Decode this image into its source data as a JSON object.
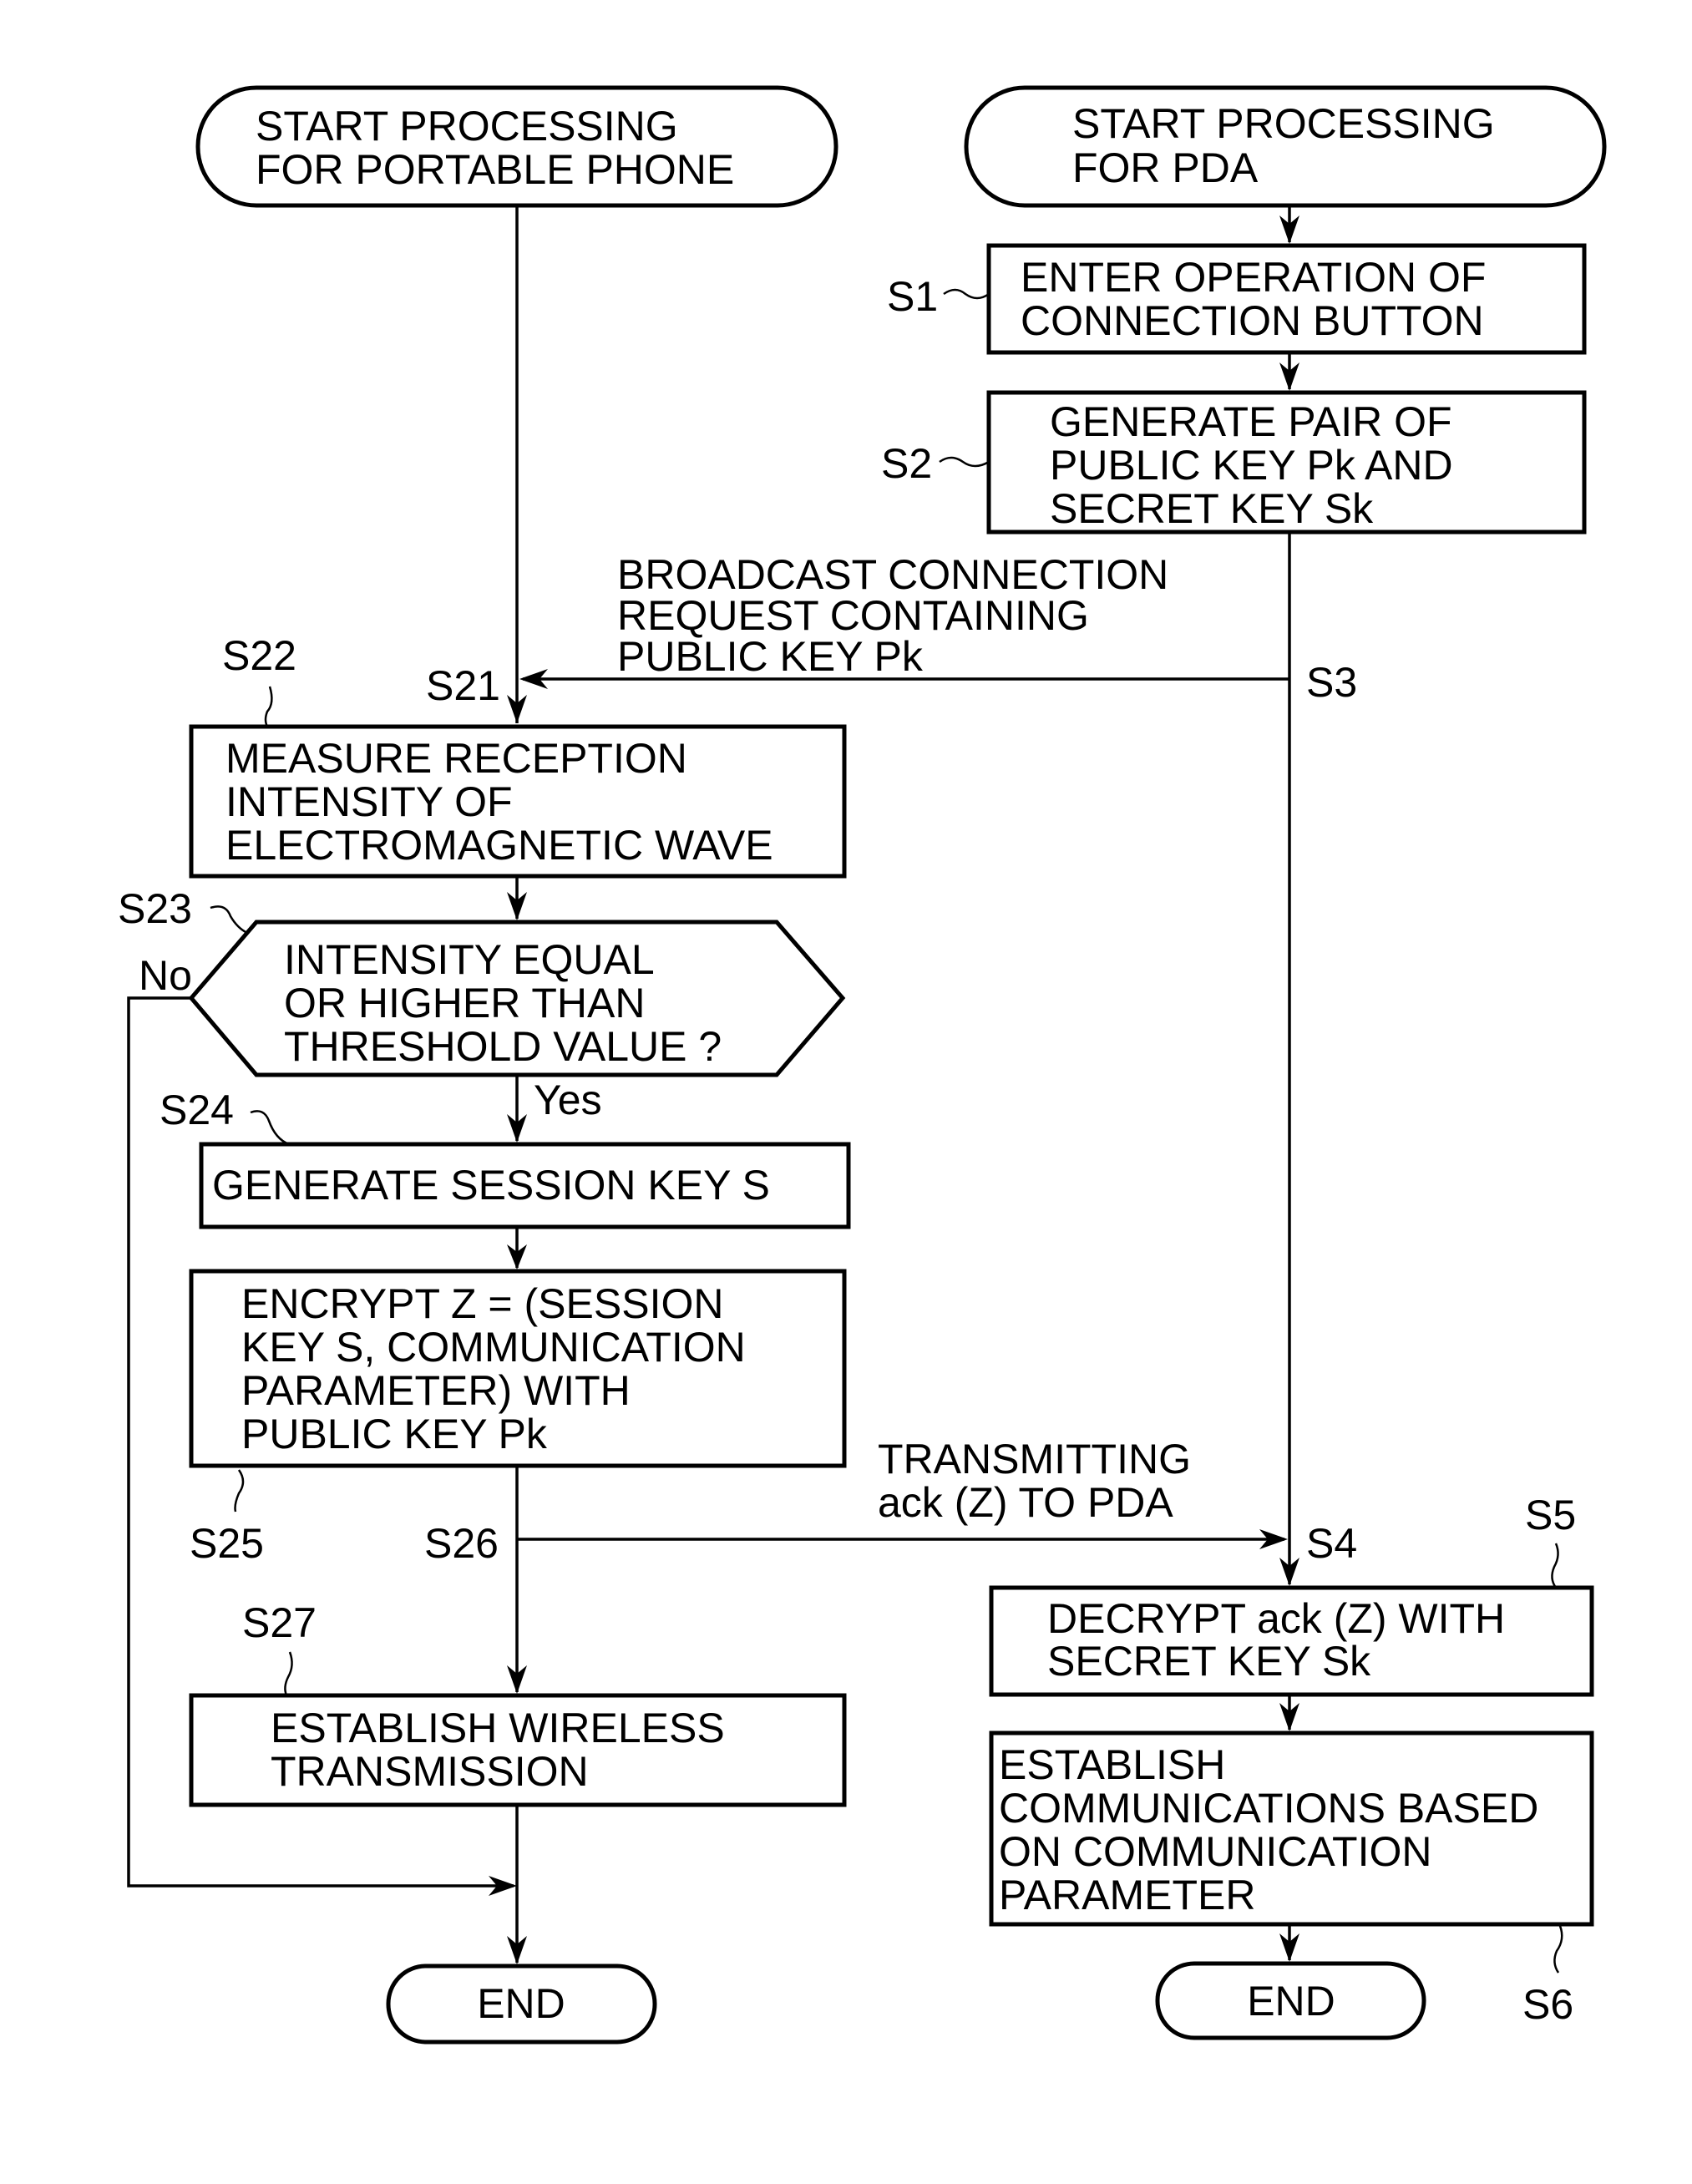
{
  "terminals": {
    "phone_start": [
      "START PROCESSING",
      "FOR PORTABLE PHONE"
    ],
    "pda_start": [
      "START PROCESSING",
      "FOR PDA"
    ],
    "phone_end": "END",
    "pda_end": "END"
  },
  "steps": {
    "S1": {
      "label": "S1",
      "lines": [
        "ENTER OPERATION OF",
        "CONNECTION BUTTON"
      ]
    },
    "S2": {
      "label": "S2",
      "lines": [
        "GENERATE PAIR OF",
        "PUBLIC KEY Pk AND",
        "SECRET KEY Sk"
      ]
    },
    "S3": {
      "label": "S3"
    },
    "S4": {
      "label": "S4"
    },
    "S5": {
      "label": "S5",
      "lines": [
        "DECRYPT ack (Z) WITH",
        "SECRET KEY Sk"
      ]
    },
    "S6": {
      "label": "S6",
      "lines": [
        "ESTABLISH",
        "COMMUNICATIONS BASED",
        "ON COMMUNICATION",
        "PARAMETER"
      ]
    },
    "S21": {
      "label": "S21"
    },
    "S22": {
      "label": "S22",
      "lines": [
        "MEASURE RECEPTION",
        "INTENSITY OF",
        "ELECTROMAGNETIC WAVE"
      ]
    },
    "S23": {
      "label": "S23",
      "lines": [
        "INTENSITY EQUAL",
        "OR HIGHER THAN",
        "THRESHOLD VALUE ?"
      ],
      "yes": "Yes",
      "no": "No"
    },
    "S24": {
      "label": "S24",
      "lines": [
        "GENERATE SESSION KEY S"
      ]
    },
    "S25": {
      "label": "S25",
      "lines": [
        "ENCRYPT Z = (SESSION",
        "KEY S, COMMUNICATION",
        "PARAMETER) WITH",
        "PUBLIC KEY Pk"
      ]
    },
    "S26": {
      "label": "S26"
    },
    "S27": {
      "label": "S27",
      "lines": [
        "ESTABLISH WIRELESS",
        "TRANSMISSION"
      ]
    }
  },
  "messages": {
    "broadcast": [
      "BROADCAST CONNECTION",
      "REQUEST CONTAINING",
      "PUBLIC KEY Pk"
    ],
    "transmit": [
      "TRANSMITTING",
      "ack (Z) TO PDA"
    ]
  }
}
